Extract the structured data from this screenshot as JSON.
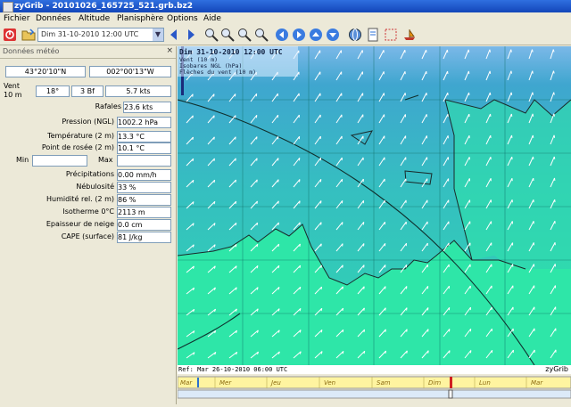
{
  "window": {
    "title": "zyGrib - 20101026_165725_521.grb.bz2"
  },
  "menu": [
    "Fichier",
    "Données",
    "Altitude",
    "Planisphère",
    "Options",
    "Aide"
  ],
  "toolbar": {
    "date_value": "Dim 31-10-2010 12:00 UTC"
  },
  "panel": {
    "title": "Données météo",
    "close": "×",
    "lat": "43°20'10\"N",
    "lon": "002°00'13\"W",
    "wind_label": "Vent\n10 m",
    "wind_dir": "18°",
    "wind_bf": "3 Bf",
    "wind_speed": "5.7 kts",
    "gust_label": "Rafales",
    "gust_value": "23.6 kts",
    "rows": [
      {
        "label": "Pression (NGL)",
        "value": "1002.2 hPa"
      },
      {
        "label": "Température (2 m)",
        "value": "13.3 °C"
      },
      {
        "label": "Point de rosée (2 m)",
        "value": "10.1 °C"
      }
    ],
    "min_label": "Min",
    "max_label": "Max",
    "rows2": [
      {
        "label": "Précipitations",
        "value": "0.00 mm/h"
      },
      {
        "label": "Nébulosité",
        "value": "33 %"
      },
      {
        "label": "Humidité rel. (2 m)",
        "value": "86 %"
      },
      {
        "label": "Isotherme 0°C",
        "value": "2113 m"
      },
      {
        "label": "Epaisseur de neige",
        "value": "0.0 cm"
      },
      {
        "label": "CAPE (surface)",
        "value": "81 J/kg"
      }
    ]
  },
  "map": {
    "header_date": "Dim 31-10-2010 12:00 UTC",
    "legend": [
      "Vent (10 m)",
      "Isobares NGL (hPa)",
      "Flèches du vent (10 m)"
    ]
  },
  "statusbar": {
    "ref": "Ref: Mar 26-10-2010 06:00 UTC",
    "app": "zyGrib"
  },
  "timeline": {
    "days": [
      "Mar",
      "Mer",
      "Jeu",
      "Ven",
      "Sam",
      "Dim",
      "Lun",
      "Mar"
    ]
  },
  "colors": {
    "title": "#1f5ad0",
    "map_land": "#2ee6a8",
    "map_sea": "#3cc8c0",
    "map_top": "#7bb8e8"
  }
}
